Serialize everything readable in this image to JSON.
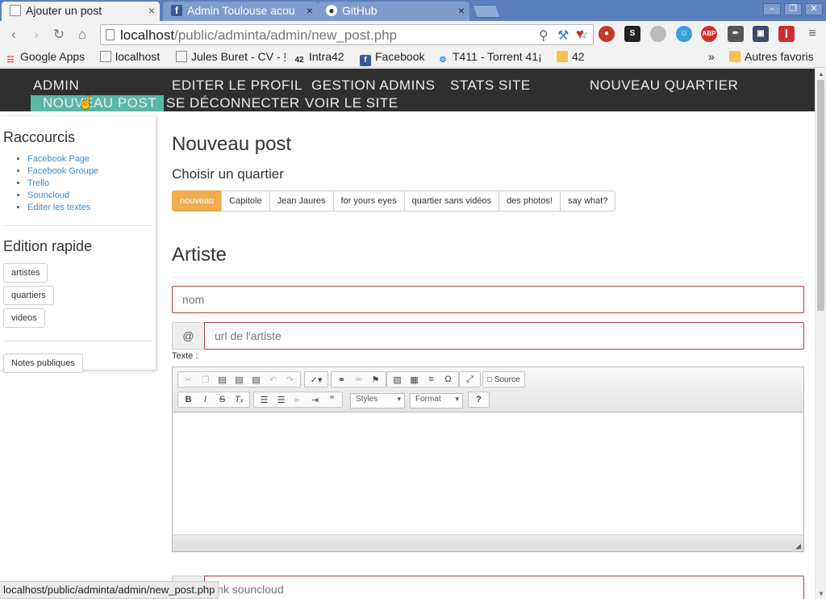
{
  "browser": {
    "tabs": [
      {
        "title": "Ajouter un post",
        "icon": "page-icon",
        "active": true
      },
      {
        "title": "Admin Toulouse acou",
        "icon": "facebook-icon",
        "active": false
      },
      {
        "title": "GitHub",
        "icon": "github-icon",
        "active": false
      }
    ],
    "tab_close_glyph": "×",
    "url_host": "localhost",
    "url_path": "/public/adminta/admin/new_post.php",
    "window_controls": [
      "–",
      "❐",
      "✕"
    ]
  },
  "bookmarks": [
    {
      "label": "Google Apps",
      "icon": "apps-grid-icon"
    },
    {
      "label": "localhost",
      "icon": "page-icon"
    },
    {
      "label": "Jules Buret - CV - §",
      "icon": "page-icon"
    },
    {
      "label": "Intra42",
      "icon": "intra42-icon"
    },
    {
      "label": "Facebook",
      "icon": "facebook-icon"
    },
    {
      "label": "T411 - Torrent 41¡",
      "icon": "t411-icon"
    },
    {
      "label": "42",
      "icon": "folder-icon"
    }
  ],
  "bookmarks_overflow": "»",
  "bookmarks_other": "Autres favoris",
  "site_nav": {
    "row1": [
      "ADMIN",
      "EDITER LE PROFIL",
      "GESTION ADMINS",
      "STATS SITE",
      "NOUVEAU QUARTIER"
    ],
    "row2": [
      "NOUVEAU POST",
      "SE DÉCONNECTER",
      "VOIR LE SITE"
    ]
  },
  "sidebar": {
    "shortcuts_title": "Raccourcis",
    "shortcuts": [
      "Facebook Page",
      "Facebook Groupe",
      "Trello",
      "Souncloud",
      "Editer les textes"
    ],
    "quick_edit_title": "Edition rapide",
    "quick_edit_buttons": [
      "artistes",
      "quartiers",
      "videos"
    ],
    "notes_button": "Notes publiques"
  },
  "main": {
    "title": "Nouveau post",
    "choose_label": "Choisir un quartier",
    "quartiers": [
      "nouveau",
      "Capitole",
      "Jean Jaures",
      "for yours eyes",
      "quartier sans vidéos",
      "des photos!",
      "say what?"
    ],
    "selected_quartier": "nouveau",
    "artiste_heading": "Artiste",
    "nom_placeholder": "nom",
    "url_addon": "@",
    "url_placeholder": "url de l'artiste",
    "texte_label": "Texte :",
    "soundcloud_addon": "@",
    "soundcloud_placeholder": "lnk souncloud"
  },
  "editor": {
    "source_label": "Source",
    "styles_label": "Styles",
    "format_label": "Format",
    "help_label": "?"
  },
  "status_url": "localhost/public/adminta/admin/new_post.php",
  "colors": {
    "tab_strip": "#5b7fba",
    "nav_bg": "#2f2f2f",
    "nav_active": "#5ab8a4",
    "selected_btn": "#f0ad4e",
    "error_border": "#a94442",
    "link": "#428bca"
  }
}
